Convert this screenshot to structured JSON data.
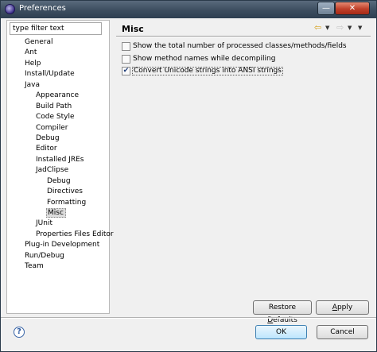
{
  "window": {
    "title": "Preferences",
    "minimize_glyph": "—",
    "close_glyph": "✕"
  },
  "icons": {
    "app": "eclipse-icon",
    "help": "help-icon",
    "back": "back-arrow-icon",
    "forward": "forward-arrow-icon",
    "menu": "dropdown-arrow-icon"
  },
  "colors": {
    "titlebar": "#3c4d5f",
    "close_button": "#c0402a",
    "checkbox_mark": "#1e3c78",
    "back_arrow": "#d6a01a"
  },
  "filter": {
    "value": "type filter text"
  },
  "tree": [
    {
      "label": "General",
      "level": 0
    },
    {
      "label": "Ant",
      "level": 0
    },
    {
      "label": "Help",
      "level": 0
    },
    {
      "label": "Install/Update",
      "level": 0
    },
    {
      "label": "Java",
      "level": 0
    },
    {
      "label": "Appearance",
      "level": 1
    },
    {
      "label": "Build Path",
      "level": 1
    },
    {
      "label": "Code Style",
      "level": 1
    },
    {
      "label": "Compiler",
      "level": 1
    },
    {
      "label": "Debug",
      "level": 1
    },
    {
      "label": "Editor",
      "level": 1
    },
    {
      "label": "Installed JREs",
      "level": 1
    },
    {
      "label": "JadClipse",
      "level": 1
    },
    {
      "label": "Debug",
      "level": 2
    },
    {
      "label": "Directives",
      "level": 2
    },
    {
      "label": "Formatting",
      "level": 2
    },
    {
      "label": "Misc",
      "level": 2,
      "selected": true
    },
    {
      "label": "JUnit",
      "level": 1
    },
    {
      "label": "Properties Files Editor",
      "level": 1
    },
    {
      "label": "Plug-in Development",
      "level": 0
    },
    {
      "label": "Run/Debug",
      "level": 0
    },
    {
      "label": "Team",
      "level": 0
    }
  ],
  "page": {
    "title": "Misc",
    "nav": {
      "back": "⇦",
      "forward": "⇨",
      "menu": "▼"
    },
    "options": [
      {
        "label": "Show the total number of processed classes/methods/fields",
        "checked": false
      },
      {
        "label": "Show method names while decompiling",
        "checked": false
      },
      {
        "label": "Convert Unicode strings into ANSI strings",
        "checked": true
      }
    ],
    "restore_defaults": {
      "pre": "Restore ",
      "mnemonic": "D",
      "post": "efaults"
    },
    "apply": {
      "pre": "",
      "mnemonic": "A",
      "post": "pply"
    }
  },
  "footer": {
    "help": "?",
    "ok": "OK",
    "cancel": "Cancel"
  }
}
